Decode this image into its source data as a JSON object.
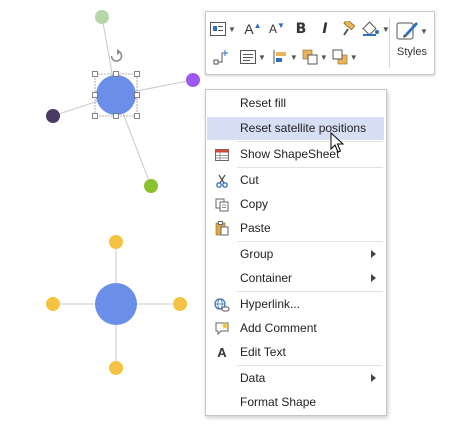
{
  "toolbar": {
    "styles_label": "Styles",
    "buttons": [
      "text-box",
      "font-grow",
      "font-shrink",
      "bold",
      "italic",
      "format-painter",
      "fill",
      "connector",
      "align",
      "bring-forward",
      "send-backward",
      "position"
    ]
  },
  "menu": {
    "items": [
      {
        "label": "Reset fill",
        "icon": "none"
      },
      {
        "label": "Reset satellite positions",
        "icon": "none",
        "highlighted": true
      },
      {
        "label": "Show ShapeSheet",
        "icon": "shapesheet-icon"
      },
      {
        "label": "Cut",
        "icon": "scissors-icon"
      },
      {
        "label": "Copy",
        "icon": "copy-icon"
      },
      {
        "label": "Paste",
        "icon": "paste-icon"
      },
      {
        "label": "Group",
        "icon": "none",
        "submenu": true
      },
      {
        "label": "Container",
        "icon": "none",
        "submenu": true
      },
      {
        "label": "Hyperlink...",
        "icon": "hyperlink-icon"
      },
      {
        "label": "Add Comment",
        "icon": "comment-icon"
      },
      {
        "label": "Edit Text",
        "icon": "text-icon"
      },
      {
        "label": "Data",
        "icon": "none",
        "submenu": true
      },
      {
        "label": "Format Shape",
        "icon": "none"
      }
    ]
  },
  "colors": {
    "hub": "#6b8fe8",
    "satellite_green_light": "#b6d7a8",
    "satellite_purple": "#9b59f0",
    "satellite_dark": "#4b3a63",
    "satellite_green": "#8bc12c",
    "satellite_yellow": "#f5c242",
    "menu_highlight": "#d7dff5"
  }
}
